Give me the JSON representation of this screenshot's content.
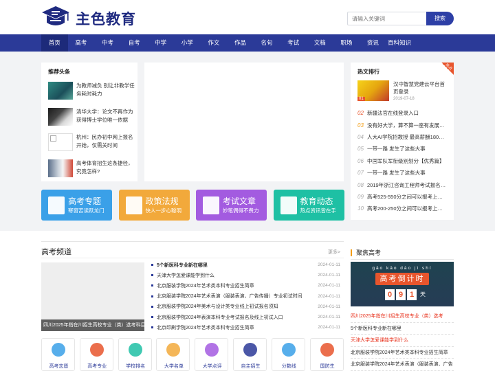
{
  "header": {
    "site_name": "主色教育",
    "search_placeholder": "请输入关键词",
    "search_button": "搜索"
  },
  "nav": [
    "首页",
    "高考",
    "中考",
    "自考",
    "中学",
    "小学",
    "作文",
    "作品",
    "名句",
    "考试",
    "文档",
    "职场",
    "资讯",
    "百科知识"
  ],
  "headlines": {
    "title": "推荐头条",
    "items": [
      "为教师减负 别让非教学任务耗时耗力",
      "清华大学：论文不再作为获得博士学位唯一依据",
      "杭州：民办初中网上报名开始，仅需关时间",
      "高考体育招生这条捷径，究竟怎样?"
    ]
  },
  "hot": {
    "title": "热文排行",
    "badge": "热点",
    "top": {
      "title": "汉中智慧党建云平台首页登录",
      "date": "2019-07-18"
    },
    "items": [
      {
        "rank": "02",
        "text": "新疆法官在线登录入口"
      },
      {
        "rank": "03",
        "text": "没有好大学，算不算一座有发展潜力的城市"
      },
      {
        "rank": "04",
        "text": "人大AI学院招教授 最高薪酬180万元"
      },
      {
        "rank": "05",
        "text": "一带一路 发生了这些大事"
      },
      {
        "rank": "06",
        "text": "中国军队军衔级别划分【优秀篇】"
      },
      {
        "rank": "07",
        "text": "一带一路 发生了这些大事"
      },
      {
        "rank": "08",
        "text": "2019年浙江咨询工程师考试报名流程"
      },
      {
        "rank": "09",
        "text": "高考525-550分之间可以报考上什么大学"
      },
      {
        "rank": "10",
        "text": "高考200-250分之间可以报考上什么大学"
      }
    ]
  },
  "tiles": [
    {
      "title": "高考专题",
      "sub": "寒窗苦读跃龙门",
      "color": "#3aa0e8"
    },
    {
      "title": "政策法规",
      "sub": "快人一步心聪明",
      "color": "#f2a93b"
    },
    {
      "title": "考试文章",
      "sub": "妙笔偶得不费力",
      "color": "#a35be0"
    },
    {
      "title": "教育动态",
      "sub": "热点资讯皆在手",
      "color": "#1ec0a4"
    }
  ],
  "gaokao": {
    "title": "高考频道",
    "more": "更多>",
    "feature_caption": "四川2025年指在川招生高校专业（类）选考科目要求",
    "news": [
      {
        "text": "5个新医科专业新在哪里",
        "date": "2024-01-11",
        "bold": true
      },
      {
        "text": "天津大学怎爱课能学到什么",
        "date": "2024-01-11",
        "bold": false
      },
      {
        "text": "北京服装学院2024年艺术类本科专业招生简章",
        "date": "2024-01-11",
        "bold": false
      },
      {
        "text": "北京服装学院2024年艺术表演（服装表演、广告传播）专业初试时间",
        "date": "2024-01-11",
        "bold": false
      },
      {
        "text": "北京服装学院2024年美术与设计类专业线上初试报名须知",
        "date": "2024-01-11",
        "bold": false
      },
      {
        "text": "北京服装学院2024年表演本科专业考试报名及线上初试入口",
        "date": "2024-01-11",
        "bold": false
      },
      {
        "text": "北京印刷学院2024年艺术类本科专业招生简章",
        "date": "2024-01-11",
        "bold": false
      }
    ],
    "icons": [
      {
        "label": "高考志愿",
        "color": "#3aa0e8"
      },
      {
        "label": "高考专业",
        "color": "#e8552d"
      },
      {
        "label": "学校排名",
        "color": "#1ec0a4"
      },
      {
        "label": "大学名单",
        "color": "#f2a93b"
      },
      {
        "label": "大学点评",
        "color": "#a35be0"
      },
      {
        "label": "自主招生",
        "color": "#2b3a98"
      },
      {
        "label": "分数线",
        "color": "#3aa0e8"
      },
      {
        "label": "国防生",
        "color": "#e8552d"
      }
    ]
  },
  "focus": {
    "title": "聚焦高考",
    "countdown": {
      "pinyin": "gāo kǎo dào jì shí",
      "title": "高考倒计时",
      "digits": [
        "0",
        "9",
        "1"
      ],
      "unit": "天"
    },
    "items": [
      {
        "text": "四川2025年指在川招生高校专业（类）选考",
        "red": true
      },
      {
        "text": "5个新医科专业新在哪里",
        "red": false
      },
      {
        "text": "天津大学怎爱课能学到什么",
        "red": true
      },
      {
        "text": "北京服装学院2024年艺术类本科专业招生简章",
        "red": false
      },
      {
        "text": "北京服装学院2024年艺术表演（服装表演、广告",
        "red": false
      }
    ]
  }
}
